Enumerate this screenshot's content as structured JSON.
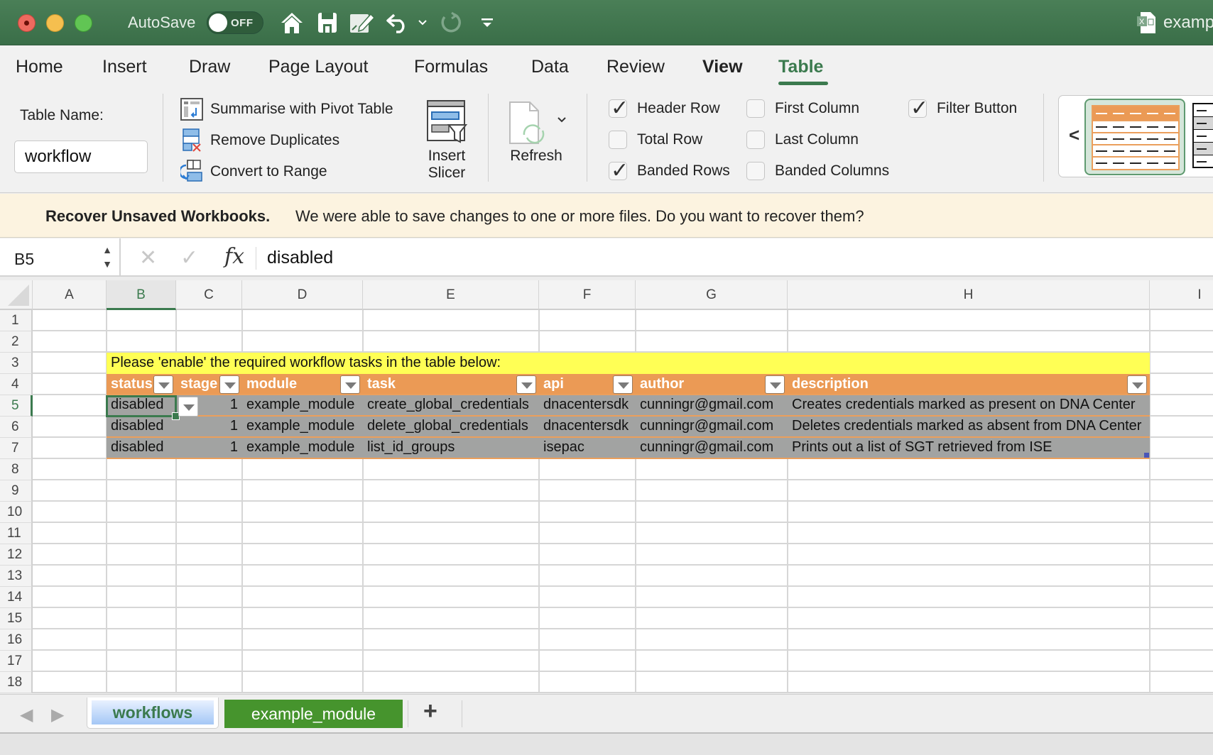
{
  "titlebar": {
    "autosave_label": "AutoSave",
    "autosave_state": "OFF",
    "file_title": "examp"
  },
  "ribbon": {
    "tabs": [
      {
        "label": "Home"
      },
      {
        "label": "Insert"
      },
      {
        "label": "Draw"
      },
      {
        "label": "Page Layout"
      },
      {
        "label": "Formulas"
      },
      {
        "label": "Data"
      },
      {
        "label": "Review"
      },
      {
        "label": "View"
      },
      {
        "label": "Table"
      }
    ],
    "active_tab": "Table",
    "table_name_label": "Table Name:",
    "table_name_value": "workflow",
    "commands": {
      "pivot": "Summarise with Pivot Table",
      "remove_duplicates": "Remove Duplicates",
      "convert_range": "Convert to Range",
      "insert_slicer_line1": "Insert",
      "insert_slicer_line2": "Slicer",
      "refresh": "Refresh"
    },
    "style_options": {
      "header_row": {
        "label": "Header Row",
        "checked": true
      },
      "total_row": {
        "label": "Total Row",
        "checked": false
      },
      "banded_rows": {
        "label": "Banded Rows",
        "checked": true
      },
      "first_column": {
        "label": "First Column",
        "checked": false
      },
      "last_column": {
        "label": "Last Column",
        "checked": false
      },
      "banded_columns": {
        "label": "Banded Columns",
        "checked": false
      },
      "filter_button": {
        "label": "Filter Button",
        "checked": true
      }
    },
    "gallery_prev": "<"
  },
  "recovery": {
    "title": "Recover Unsaved Workbooks.",
    "message": "We were able to save changes to one or more files. Do you want to recover them?"
  },
  "formula_bar": {
    "name_box": "B5",
    "cancel": "✕",
    "enter": "✓",
    "fx": "fx",
    "value": "disabled"
  },
  "grid": {
    "columns": [
      "A",
      "B",
      "C",
      "D",
      "E",
      "F",
      "G",
      "H",
      "I"
    ],
    "selected_column": "B",
    "rows": [
      "1",
      "2",
      "3",
      "4",
      "5",
      "6",
      "7",
      "8",
      "9",
      "10",
      "11",
      "12",
      "13",
      "14",
      "15",
      "16",
      "17",
      "18"
    ],
    "selected_row": "5",
    "banner": "Please 'enable' the required workflow tasks in the table below:",
    "table_headers": [
      "status",
      "stage",
      "module",
      "task",
      "api",
      "author",
      "description"
    ],
    "table_rows": [
      [
        "disabled",
        "1",
        "example_module",
        "create_global_credentials",
        "dnacentersdk",
        "cunningr@gmail.com",
        "Creates credentials marked as present on DNA Center"
      ],
      [
        "disabled",
        "1",
        "example_module",
        "delete_global_credentials",
        "dnacentersdk",
        "cunningr@gmail.com",
        "Deletes credentials marked as absent from DNA Center"
      ],
      [
        "disabled",
        "1",
        "example_module",
        "list_id_groups",
        "isepac",
        "cunningr@gmail.com",
        "Prints out a list of SGT retrieved from ISE"
      ]
    ]
  },
  "sheets": {
    "tabs": [
      {
        "label": "workflows",
        "active": true
      },
      {
        "label": "example_module",
        "active": false
      }
    ],
    "add_label": "+"
  },
  "colors": {
    "title_green": "#3f744c",
    "accent_green": "#3b7a4e",
    "table_header_orange": "#eb9a55",
    "banner_yellow": "#ffff55",
    "row_gray": "#a2a3a2",
    "sheet_tab_green": "#46942d"
  }
}
